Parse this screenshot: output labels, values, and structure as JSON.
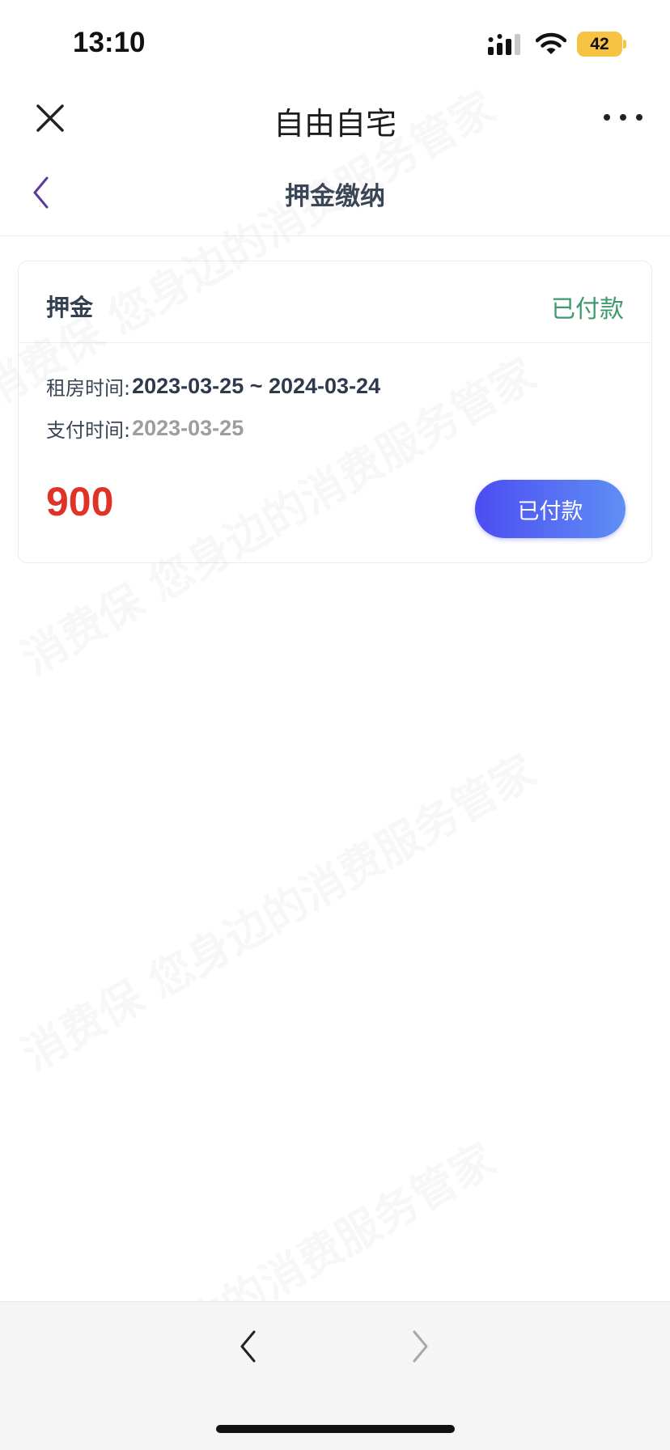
{
  "status_bar": {
    "time": "13:10",
    "battery": "42",
    "icons": [
      "signal-icon",
      "wifi-icon",
      "battery-icon"
    ],
    "battery_color": "#f6c343"
  },
  "app_header": {
    "title": "自由自宅",
    "close_icon": "close-icon",
    "more_icon": "more-icon"
  },
  "page_nav": {
    "title": "押金缴纳",
    "back_icon": "chevron-left-icon",
    "back_color": "#5b3a9b"
  },
  "deposit_card": {
    "title": "押金",
    "status": "已付款",
    "status_color": "#3c9a6e",
    "rent_period_label": "租房时间:",
    "rent_period_value": "2023-03-25 ~ 2024-03-24",
    "pay_time_label": "支付时间:",
    "pay_time_value": "2023-03-25",
    "amount": "900",
    "amount_color": "#e03226",
    "button_label": "已付款"
  },
  "watermark": {
    "text": "消费保 您身边的消费服务管家"
  },
  "bottom_bar": {
    "prev_icon": "chevron-left-icon",
    "next_icon": "chevron-right-icon"
  }
}
